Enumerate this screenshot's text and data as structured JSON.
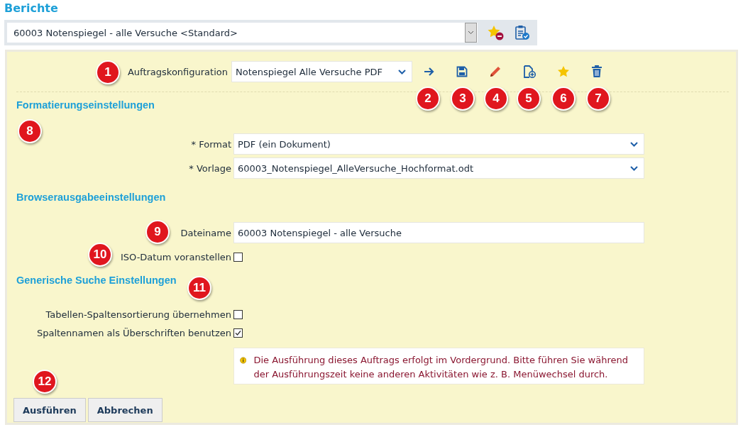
{
  "title": "Berichte",
  "report_select": {
    "value": "60003 Notenspiegel - alle Versuche <Standard>"
  },
  "config": {
    "label": "Auftragskonfiguration",
    "value": "Notenspiegel Alle Versuche PDF"
  },
  "sections": [
    {
      "heading": "Formatierungseinstellungen",
      "rows": [
        {
          "kind": "select",
          "label": "* Format",
          "value": "PDF (ein Dokument)"
        },
        {
          "kind": "select",
          "label": "* Vorlage",
          "value": "60003_Notenspiegel_AlleVersuche_Hochformat.odt"
        }
      ]
    },
    {
      "heading": "Browserausgabeeinstellungen",
      "rows": [
        {
          "kind": "input",
          "label": "Dateiname",
          "value": "60003 Notenspiegel - alle Versuche"
        },
        {
          "kind": "checkbox",
          "label": "ISO-Datum voranstellen",
          "checked": false
        }
      ]
    },
    {
      "heading": "Generische Suche Einstellungen",
      "rows": [
        {
          "kind": "checkbox",
          "label": "Tabellen-Spaltensortierung übernehmen",
          "checked": false
        },
        {
          "kind": "checkbox",
          "label": "Spaltennamen als Überschriften benutzen",
          "checked": true
        }
      ]
    }
  ],
  "info": "Die Ausführung dieses Auftrags erfolgt im Vordergrund. Bitte führen Sie während der Ausführungszeit keine anderen Aktivitäten wie z. B. Menüwechsel durch.",
  "buttons": [
    "Ausführen",
    "Abbrechen"
  ],
  "callouts": [
    "1",
    "2",
    "3",
    "4",
    "5",
    "6",
    "7",
    "8",
    "9",
    "10",
    "11",
    "12"
  ]
}
